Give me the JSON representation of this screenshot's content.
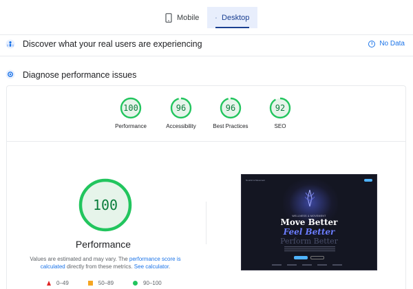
{
  "tabs": [
    {
      "label": "Mobile",
      "icon": "mobile-icon",
      "active": false
    },
    {
      "label": "Desktop",
      "icon": "desktop-icon",
      "active": true
    }
  ],
  "field_data": {
    "title": "Discover what your real users are experiencing",
    "status": "No Data"
  },
  "diagnose": {
    "title": "Diagnose performance issues"
  },
  "scores": [
    {
      "label": "Performance",
      "value": "100"
    },
    {
      "label": "Accessibility",
      "value": "96"
    },
    {
      "label": "Best Practices",
      "value": "96"
    },
    {
      "label": "SEO",
      "value": "92"
    }
  ],
  "performance": {
    "score": "100",
    "title": "Performance",
    "note_pre": "Values are estimated and may vary. The ",
    "note_link1": "performance score is calculated",
    "note_mid": " directly from these metrics. ",
    "note_link2": "See calculator",
    "note_post": "."
  },
  "legend": [
    {
      "shape": "triangle",
      "range": "0–49",
      "color": "#e02626"
    },
    {
      "shape": "square",
      "range": "50–89",
      "color": "#f5a623"
    },
    {
      "shape": "circle",
      "range": "90–100",
      "color": "#22c55e"
    }
  ],
  "preview": {
    "brand": "Nourish & Movement",
    "subtitle": "WELLNESS & MOVEMENT",
    "headline1": "Move Better",
    "headline2": "Feel Better",
    "headline3": "Perform Better"
  },
  "colors": {
    "pass": "#22c55e",
    "pass_text": "#0a7d3c",
    "accent": "#1a73e8"
  }
}
